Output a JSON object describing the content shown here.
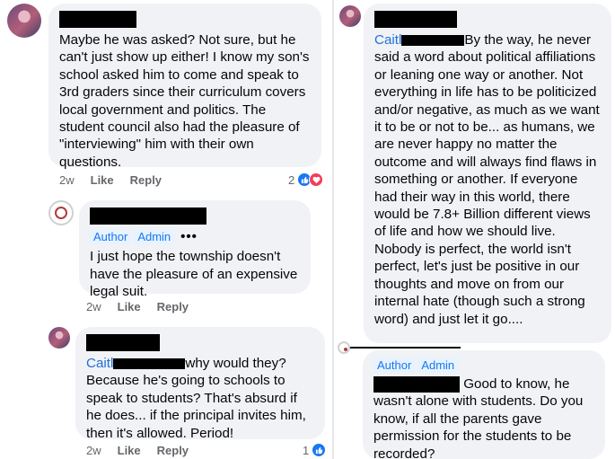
{
  "left": {
    "comment1": {
      "text": "Maybe he was asked? Not sure, but he can't just show up either! I know my son's school asked him to come and speak to 3rd graders since their curriculum covers local government and politics. The student council also had the pleasure of \"interviewing\" him with their own questions.",
      "time": "2w",
      "like": "Like",
      "reply": "Reply",
      "reaction_count": "2"
    },
    "comment2": {
      "badges": [
        "Author",
        "Admin"
      ],
      "more": "•••",
      "text": "I just hope the township doesn't have the pleasure of an expensive legal suit.",
      "time": "2w",
      "like": "Like",
      "reply": "Reply"
    },
    "comment3": {
      "mention": "Caitl",
      "text_first": "why would they?",
      "text_rest": "Because he's going to schools to speak to students? That's absurd if he does... if the principal invites him, then it's allowed. Period!",
      "time": "2w",
      "like": "Like",
      "reply": "Reply",
      "reaction_count": "1"
    }
  },
  "right": {
    "comment4": {
      "mention": "Caitl",
      "text_first": "By the way, he never",
      "text_rest": "said a word about political affiliations or leaning one way or another.  Not everything in life has to be politicized and/or negative, as much as we want it to be or not to be... as humans, we are never happy no matter the outcome and will always find flaws in something or another. If everyone had their way in this world, there would be 7.8+ Billion different views of life and how we should live. Nobody is perfect, the world isn't perfect, let's just be positive in our thoughts and move on from our internal hate (though such a strong word) and just let it go...."
    },
    "comment5": {
      "badges": [
        "Author",
        "Admin"
      ],
      "text_first": "Good to know, he",
      "text_rest": "wasn't alone with students.  Do you know, if all the parents gave permission for the students to be recorded?"
    }
  },
  "colors": {
    "bubble": "#f0f2f5",
    "meta": "#65676b",
    "link": "#216fdb",
    "like": "#1877f2",
    "love": "#f33e58"
  },
  "icons": [
    "avatar-photo",
    "township-seal",
    "like-reaction-icon",
    "love-reaction-icon",
    "more-dots-icon"
  ]
}
